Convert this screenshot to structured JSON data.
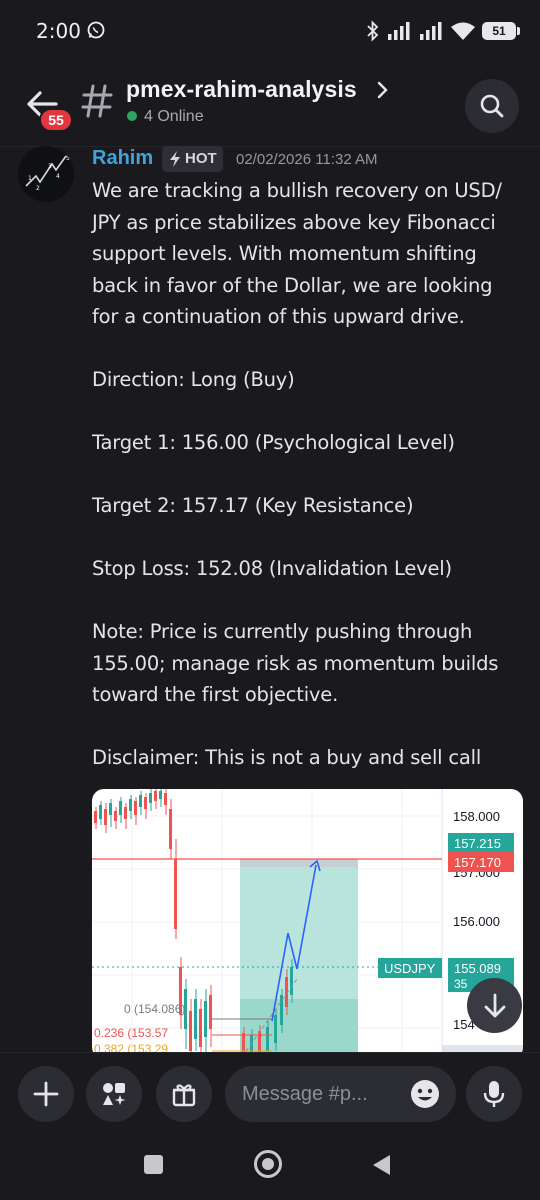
{
  "status_bar": {
    "time": "2:00",
    "battery": "51"
  },
  "header": {
    "unread_count": "55",
    "channel_name": "pmex-rahim-analysis",
    "online_text": "4 Online"
  },
  "message": {
    "author": "Rahim",
    "role_tag": "HOT",
    "timestamp": "02/02/2026 11:32 AM",
    "text": "We are tracking a bullish recovery on USD/\nJPY as price stabilizes above key Fibonacci\nsupport levels. With momentum shifting\nback in favor of the Dollar, we are looking\nfor a continuation of this upward drive.\n\nDirection: Long (Buy)\n\nTarget 1: 156.00 (Psychological Level)\n\nTarget 2: 157.17 (Key Resistance)\n\nStop Loss: 152.08 (Invalidation Level)\n\nNote: Price is currently pushing through\n155.00; manage risk as momentum builds\ntoward the first objective.\n\nDisclaimer: This is not a buy and sell call"
  },
  "chart_image": {
    "price_ticks": [
      "158.000",
      "157.000",
      "156.000",
      "154"
    ],
    "label_take_profit": "157.215",
    "label_resistance": "157.170",
    "label_symbol": "USDJPY",
    "label_current": "155.089",
    "label_current_sub": "35",
    "fib_0": "0 (154.086)",
    "fib_0236": "0.236 (153.57",
    "fib_0382": "0.382 (153.29",
    "colors": {
      "take_profit": "#26a69a",
      "resistance": "#ef5350",
      "projection": "#2962ff"
    }
  },
  "composer": {
    "placeholder": "Message #p..."
  },
  "icons": {
    "back": "arrow-left-icon",
    "channel": "hash-icon",
    "search": "search-icon",
    "add": "plus-icon",
    "apps": "apps-icon",
    "gift": "gift-icon",
    "emoji": "emoji-icon",
    "mic": "microphone-icon",
    "scroll": "arrow-down-icon"
  }
}
